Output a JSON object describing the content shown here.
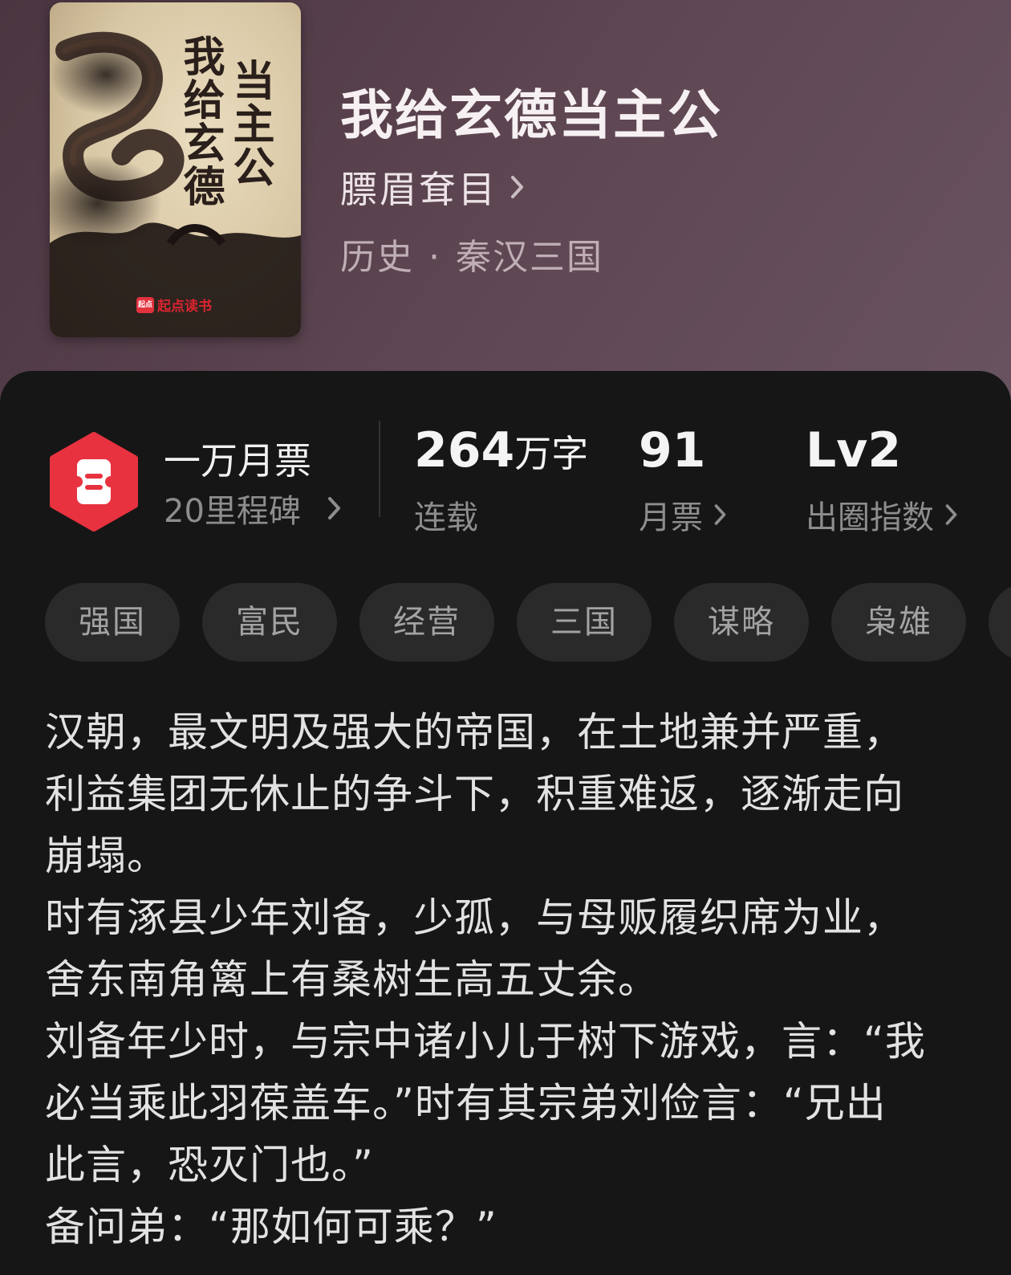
{
  "book": {
    "title": "我给玄德当主公",
    "author": "膘眉耷目",
    "genre": "历史",
    "separator": "·",
    "subgenre": "秦汉三国",
    "cover": {
      "title_col1": "当主公",
      "title_col2": "我给玄德",
      "logo_text": "起点",
      "brand": "起点读书"
    }
  },
  "honor": {
    "icon": "ticket-hexagon-icon",
    "title": "一万月票",
    "subtitle": "20里程碑"
  },
  "stats": {
    "word_count": {
      "number": "264",
      "unit": "万字",
      "label": "连载"
    },
    "monthly_tickets": {
      "value": "91",
      "label": "月票"
    },
    "index": {
      "value": "Lv2",
      "label": "出圈指数"
    }
  },
  "tags": [
    "强国",
    "富民",
    "经营",
    "三国",
    "谋略",
    "枭雄"
  ],
  "synopsis": [
    "汉朝，最文明及强大的帝国，在土地兼并严重，",
    "利益集团无休止的争斗下，积重难返，逐渐走向",
    "崩塌。",
    "时有涿县少年刘备，少孤，与母贩履织席为业，",
    "舍东南角篱上有桑树生高五丈余。",
    "刘备年少时，与宗中诸小儿于树下游戏，言：“我",
    "必当乘此羽葆盖车。”时有其宗弟刘俭言：“兄出",
    "此言，恐灭门也。”",
    "备问弟：“那如何可乘？”"
  ],
  "colors": {
    "header_bg": "#5e4652",
    "panel_bg": "#161616",
    "honor_red": "#e8323f",
    "tag_bg": "#2a2a2a"
  }
}
